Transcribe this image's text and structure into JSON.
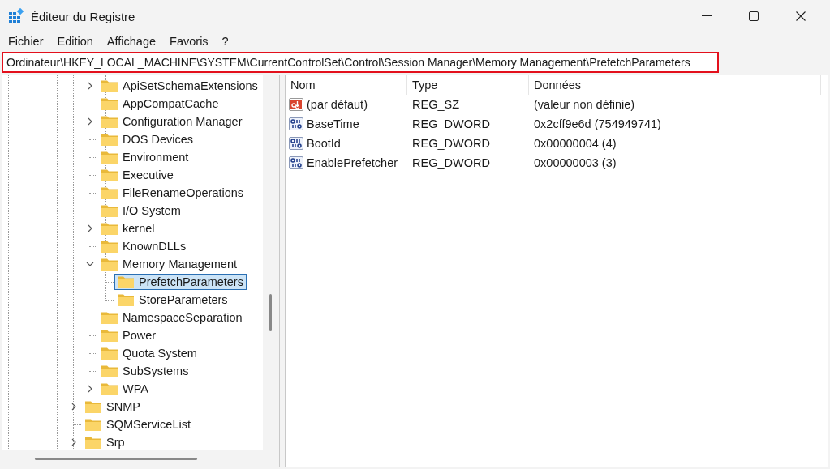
{
  "window": {
    "title": "Éditeur du Registre"
  },
  "menu": [
    "Fichier",
    "Edition",
    "Affichage",
    "Favoris",
    "?"
  ],
  "address_bar": {
    "value": "Ordinateur\\HKEY_LOCAL_MACHINE\\SYSTEM\\CurrentControlSet\\Control\\Session Manager\\Memory Management\\PrefetchParameters",
    "highlighted": true
  },
  "tree": [
    {
      "children": [
        {
          "label": "ApiSetSchemaExtensions",
          "expanded": false,
          "selected": false
        },
        {
          "label": "AppCompatCache",
          "selected": false
        },
        {
          "label": "Configuration Manager",
          "expanded": false,
          "selected": false
        },
        {
          "label": "DOS Devices",
          "selected": false
        },
        {
          "label": "Environment",
          "selected": false
        },
        {
          "label": "Executive",
          "selected": false
        },
        {
          "label": "FileRenameOperations",
          "selected": false
        },
        {
          "label": "I/O System",
          "selected": false
        },
        {
          "label": "kernel",
          "expanded": false,
          "selected": false
        },
        {
          "label": "KnownDLLs",
          "selected": false
        },
        {
          "label": "Memory Management",
          "expanded": true,
          "selected": false,
          "children": [
            {
              "label": "PrefetchParameters",
              "selected": true
            },
            {
              "label": "StoreParameters",
              "selected": false
            }
          ]
        },
        {
          "label": "NamespaceSeparation",
          "selected": false
        },
        {
          "label": "Power",
          "selected": false
        },
        {
          "label": "Quota System",
          "selected": false
        },
        {
          "label": "SubSystems",
          "selected": false
        },
        {
          "label": "WPA",
          "expanded": false,
          "selected": false
        }
      ]
    },
    {
      "label": "SNMP",
      "expanded": false,
      "selected": false
    },
    {
      "label": "SQMServiceList",
      "selected": false
    },
    {
      "label": "Srp",
      "expanded": false,
      "selected": false
    }
  ],
  "values": {
    "columns": [
      "Nom",
      "Type",
      "Données"
    ],
    "rows": [
      {
        "kind": "string",
        "name": "(par défaut)",
        "type": "REG_SZ",
        "data": "(valeur non définie)"
      },
      {
        "kind": "binary",
        "name": "BaseTime",
        "type": "REG_DWORD",
        "data": "0x2cff9e6d (754949741)"
      },
      {
        "kind": "binary",
        "name": "BootId",
        "type": "REG_DWORD",
        "data": "0x00000004 (4)"
      },
      {
        "kind": "binary",
        "name": "EnablePrefetcher",
        "type": "REG_DWORD",
        "data": "0x00000003 (3)"
      }
    ]
  }
}
